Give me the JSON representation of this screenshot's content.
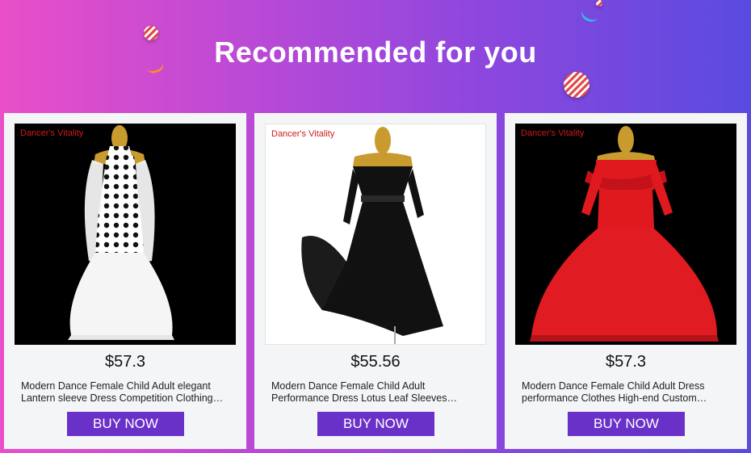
{
  "header": {
    "title": "Recommended for you"
  },
  "products": [
    {
      "brand": "Dancer's Vitality",
      "price": "$57.3",
      "title": "Modern Dance Female Child Adult elegant Lantern sleeve Dress Competition Clothing Ballroom",
      "button": "BUY NOW",
      "dress_color": "#ffffff",
      "image_background": "#000000"
    },
    {
      "brand": "Dancer's Vitality",
      "price": "$55.56",
      "title": "Modern Dance Female Child Adult Performance Dress Lotus Leaf Sleeves Ballroom Dress",
      "button": "BUY NOW",
      "dress_color": "#111111",
      "image_background": "#ffffff"
    },
    {
      "brand": "Dancer's Vitality",
      "price": "$57.3",
      "title": "Modern Dance Female Child Adult Dress performance Clothes High-end Custom Ballroom Dress",
      "button": "BUY NOW",
      "dress_color": "#e0191f",
      "image_background": "#000000"
    }
  ]
}
